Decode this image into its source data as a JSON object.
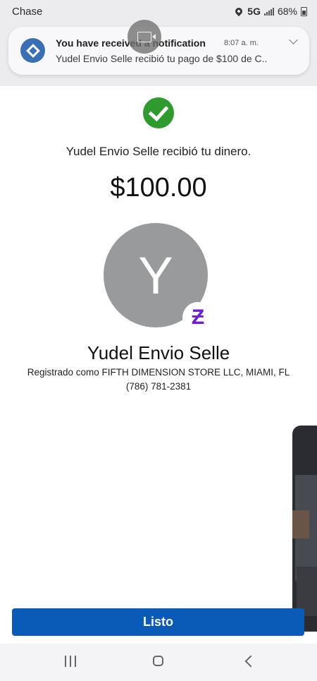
{
  "status_bar": {
    "carrier": "Chase",
    "network": "5G",
    "battery": "68%",
    "icons": [
      "location-icon",
      "signal-icon",
      "battery-icon"
    ]
  },
  "notification": {
    "title": "You have received a notification",
    "time": "8:07 a. m.",
    "body": "Yudel Envio Selle recibió tu pago de $100 de C..",
    "app_icon": "chase-logo-icon"
  },
  "confirmation": {
    "message": "Yudel Envio Selle recibió tu dinero.",
    "amount": "$100.00"
  },
  "recipient": {
    "initial": "Y",
    "name": "Yudel Envio Selle",
    "registered_as": "Registrado como FIFTH DIMENSION STORE LLC, MIAMI, FL",
    "phone": "(786) 781-2381",
    "badge": "Ƶ"
  },
  "actions": {
    "done_label": "Listo"
  },
  "colors": {
    "success": "#2f9b2f",
    "primary_button": "#0a5ab8",
    "zelle_purple": "#6d1ed4",
    "avatar_bg": "#999a9c"
  }
}
